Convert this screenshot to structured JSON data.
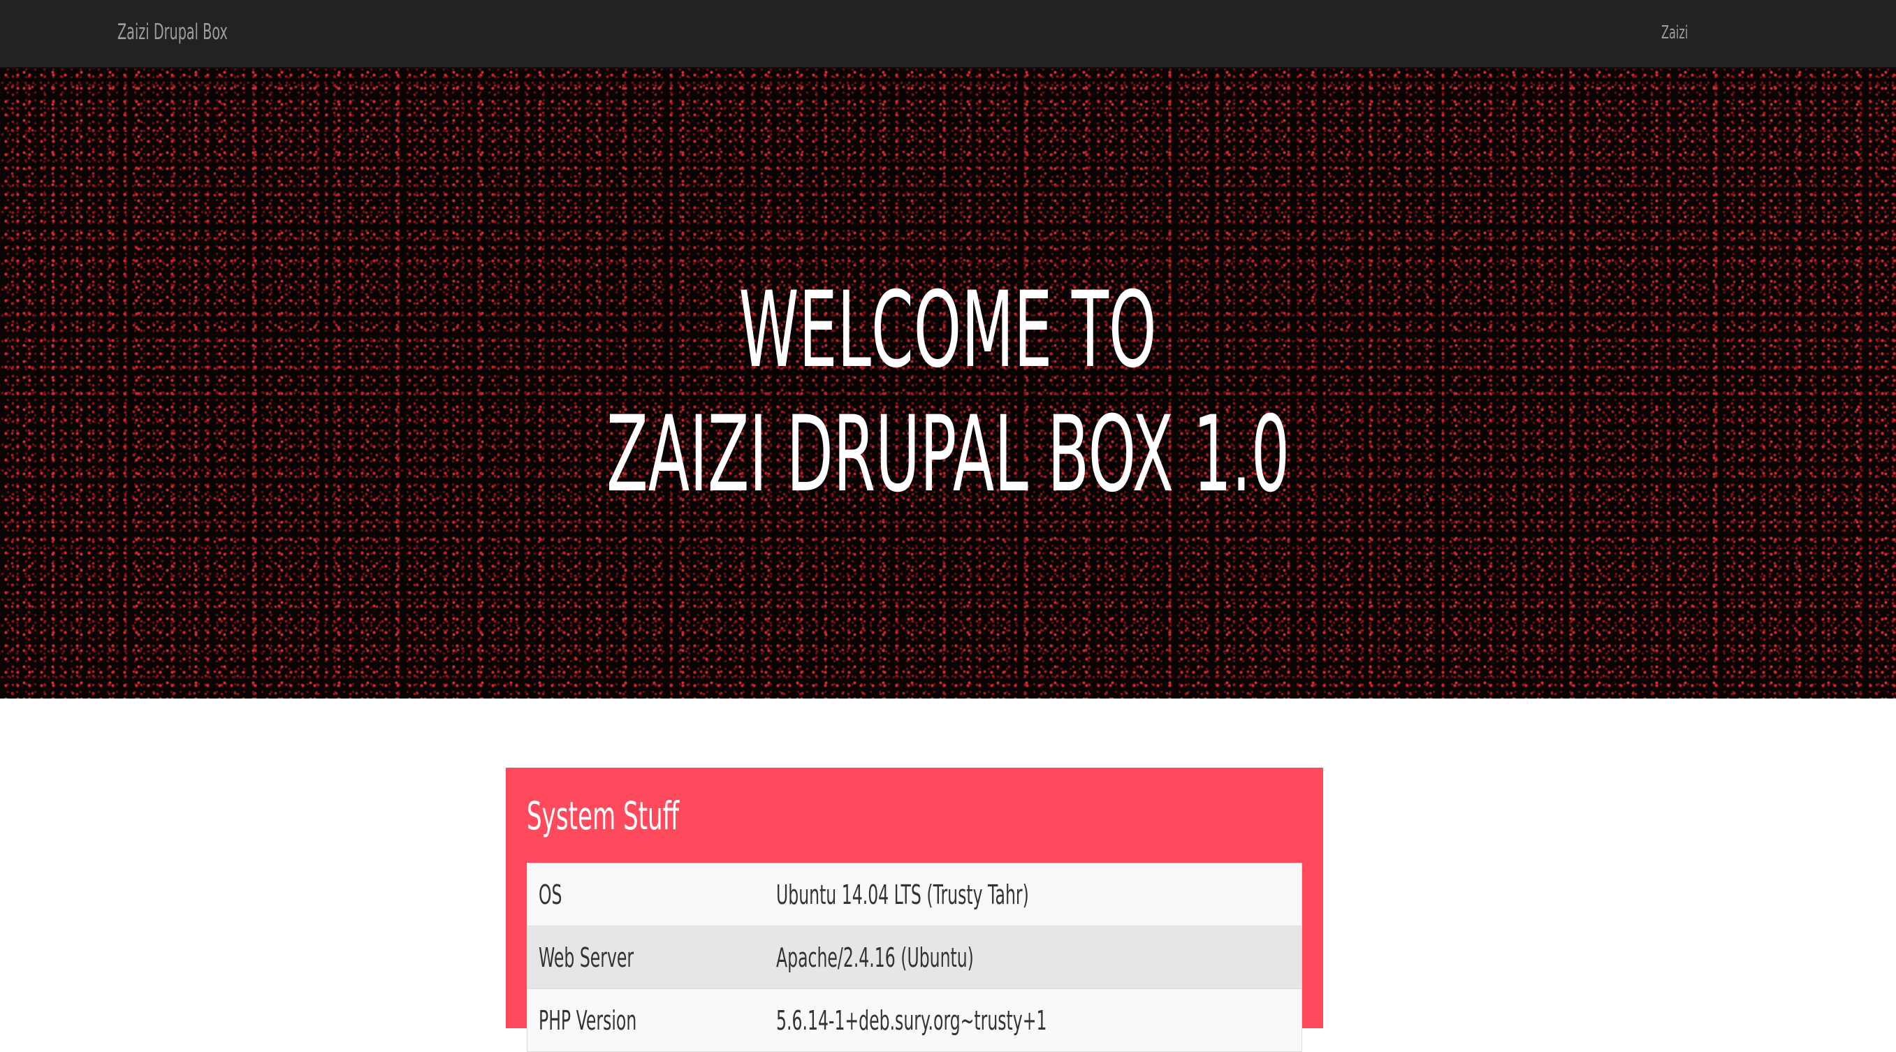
{
  "navbar": {
    "brand": "Zaizi Drupal Box",
    "link": "Zaizi",
    "background": "#222222",
    "text_color": "#9d9d9d"
  },
  "hero": {
    "line1": "WELCOME TO",
    "line2": "ZAIZI DRUPAL BOX 1.0",
    "background": "#0a0404",
    "dot_color": "#e62d32"
  },
  "system_panel": {
    "title": "System Stuff",
    "accent": "#ff4a5d",
    "rows": [
      {
        "label": "OS",
        "value": "Ubuntu 14.04 LTS (Trusty Tahr)"
      },
      {
        "label": "Web Server",
        "value": "Apache/2.4.16 (Ubuntu)"
      },
      {
        "label": "PHP Version",
        "value": "5.6.14-1+deb.sury.org~trusty+1"
      }
    ]
  }
}
